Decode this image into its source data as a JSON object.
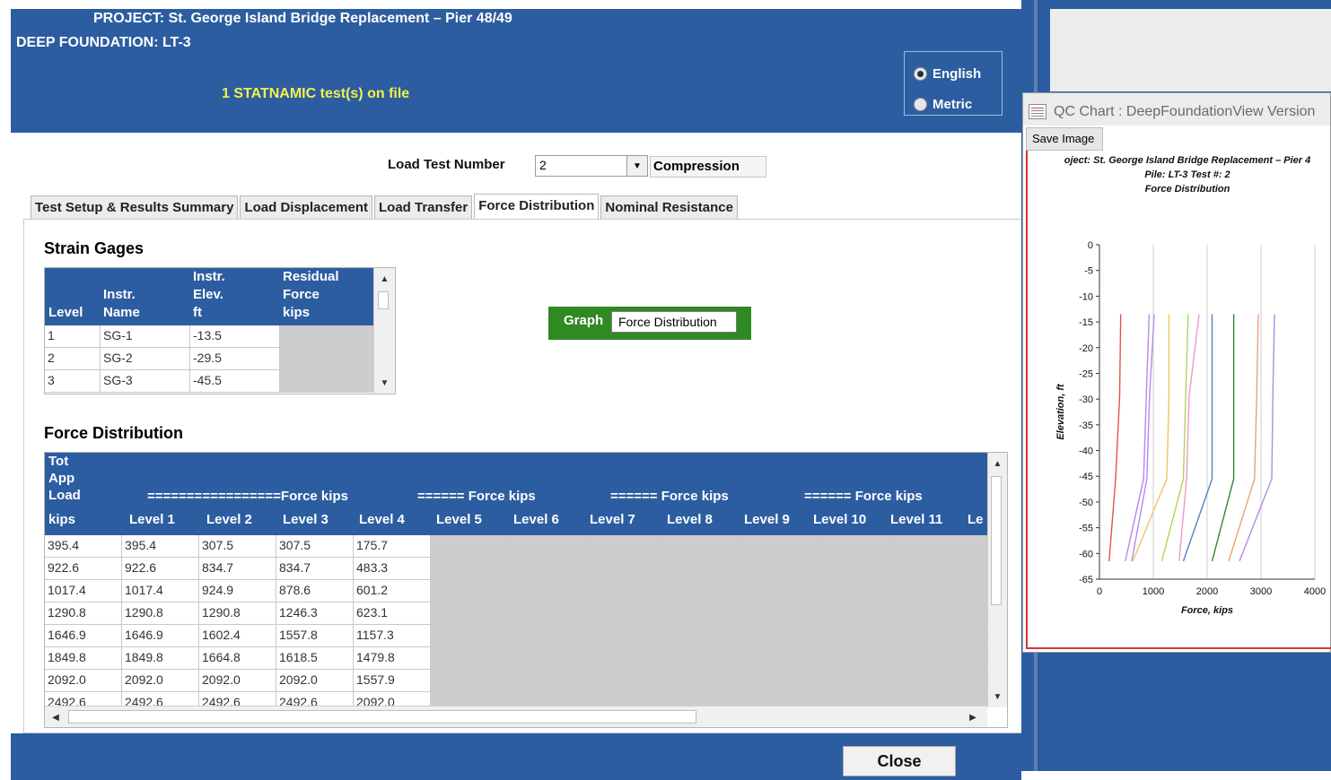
{
  "header": {
    "project": "PROJECT:  St. George Island Bridge Replacement – Pier 48/49",
    "foundation": "DEEP FOUNDATION:  LT-3",
    "tests_on_file": "1 STATNAMIC test(s) on file",
    "units": {
      "english": "English",
      "metric": "Metric",
      "selected": "English"
    }
  },
  "load_test": {
    "label": "Load Test Number",
    "value": "2",
    "direction": "Compression"
  },
  "tabs": [
    {
      "label": "Test Setup & Results Summary",
      "active": false
    },
    {
      "label": "Load Displacement",
      "active": false
    },
    {
      "label": "Load Transfer",
      "active": false
    },
    {
      "label": "Force Distribution",
      "active": true
    },
    {
      "label": "Nominal Resistance",
      "active": false
    }
  ],
  "strain_gages": {
    "title": "Strain Gages",
    "headers": {
      "level": "Level",
      "name": [
        "Instr.",
        "Name"
      ],
      "elev": [
        "Instr.",
        "Elev.",
        "ft"
      ],
      "residual": [
        "Residual",
        "Force",
        "kips"
      ]
    },
    "rows": [
      {
        "level": "1",
        "name": "SG-1",
        "elev": "-13.5",
        "residual": ""
      },
      {
        "level": "2",
        "name": "SG-2",
        "elev": "-29.5",
        "residual": ""
      },
      {
        "level": "3",
        "name": "SG-3",
        "elev": "-45.5",
        "residual": ""
      }
    ]
  },
  "graph": {
    "label": "Graph",
    "selected": "Force Distribution"
  },
  "force_distribution": {
    "title": "Force Distribution",
    "tot_header": [
      "Tot",
      "App",
      "Load",
      "kips"
    ],
    "group_headers": [
      "=================Force   kips",
      "======  Force   kips",
      "======  Force   kips",
      "======  Force   kips"
    ],
    "level_headers": [
      "Level 1",
      "Level 2",
      "Level 3",
      "Level 4",
      "Level 5",
      "Level 6",
      "Level 7",
      "Level 8",
      "Level 9",
      "Level 10",
      "Level 11",
      "Le"
    ],
    "rows": [
      [
        "395.4",
        "395.4",
        "307.5",
        "307.5",
        "175.7"
      ],
      [
        "922.6",
        "922.6",
        "834.7",
        "834.7",
        "483.3"
      ],
      [
        "1017.4",
        "1017.4",
        "924.9",
        "878.6",
        "601.2"
      ],
      [
        "1290.8",
        "1290.8",
        "1290.8",
        "1246.3",
        "623.1"
      ],
      [
        "1646.9",
        "1646.9",
        "1602.4",
        "1557.8",
        "1157.3"
      ],
      [
        "1849.8",
        "1849.8",
        "1664.8",
        "1618.5",
        "1479.8"
      ],
      [
        "2092.0",
        "2092.0",
        "2092.0",
        "2092.0",
        "1557.9"
      ],
      [
        "2492.6",
        "2492.6",
        "2492.6",
        "2492.6",
        "2092.0"
      ]
    ]
  },
  "footer": {
    "close_label": "Close"
  },
  "qc_window": {
    "title": "QC Chart : DeepFoundationView Version",
    "save_label": "Save Image"
  },
  "chart_data": {
    "type": "line",
    "title": [
      "oject: St. George Island Bridge Replacement – Pier 4",
      "Pile: LT-3 Test #: 2",
      "Force Distribution"
    ],
    "xlabel": "Force, kips",
    "ylabel": "Elevation, ft",
    "xlim": [
      0,
      4000
    ],
    "ylim": [
      -65,
      0
    ],
    "x_ticks": [
      "0",
      "1000",
      "2000",
      "3000",
      "4000"
    ],
    "y_ticks": [
      "0",
      "-5",
      "-10",
      "-15",
      "-20",
      "-25",
      "-30",
      "-35",
      "-40",
      "-45",
      "-50",
      "-55",
      "-60",
      "-65"
    ],
    "grid": true,
    "series": [
      {
        "color": "#e8504a",
        "x": [
          395,
          375,
          300,
          180
        ],
        "y": [
          -13.5,
          -29.5,
          -45.5,
          -61.5
        ]
      },
      {
        "color": "#b48ae8",
        "x": [
          923,
          870,
          820,
          480
        ],
        "y": [
          -13.5,
          -29.5,
          -45.5,
          -61.5
        ]
      },
      {
        "color": "#b48ae8",
        "x": [
          1017,
          930,
          880,
          600
        ],
        "y": [
          -13.5,
          -29.5,
          -45.5,
          -61.5
        ]
      },
      {
        "color": "#f5c060",
        "x": [
          1291,
          1291,
          1250,
          620
        ],
        "y": [
          -13.5,
          -29.5,
          -45.5,
          -61.5
        ]
      },
      {
        "color": "#b7d05a",
        "x": [
          1647,
          1602,
          1558,
          1157
        ],
        "y": [
          -13.5,
          -29.5,
          -45.5,
          -61.5
        ]
      },
      {
        "color": "#f098c8",
        "x": [
          1850,
          1665,
          1619,
          1480
        ],
        "y": [
          -13.5,
          -29.5,
          -45.5,
          -61.5
        ]
      },
      {
        "color": "#4a86c8",
        "x": [
          2092,
          2092,
          2092,
          1558
        ],
        "y": [
          -13.5,
          -29.5,
          -45.5,
          -61.5
        ]
      },
      {
        "color": "#2f8a34",
        "x": [
          2493,
          2493,
          2493,
          2092
        ],
        "y": [
          -13.5,
          -29.5,
          -45.5,
          -61.5
        ]
      },
      {
        "color": "#f0a070",
        "x": [
          2950,
          2920,
          2880,
          2400
        ],
        "y": [
          -13.5,
          -29.5,
          -45.5,
          -61.5
        ]
      },
      {
        "color": "#b48ae8",
        "x": [
          3250,
          3220,
          3200,
          2600
        ],
        "y": [
          -13.5,
          -29.5,
          -45.5,
          -61.5
        ]
      }
    ]
  }
}
